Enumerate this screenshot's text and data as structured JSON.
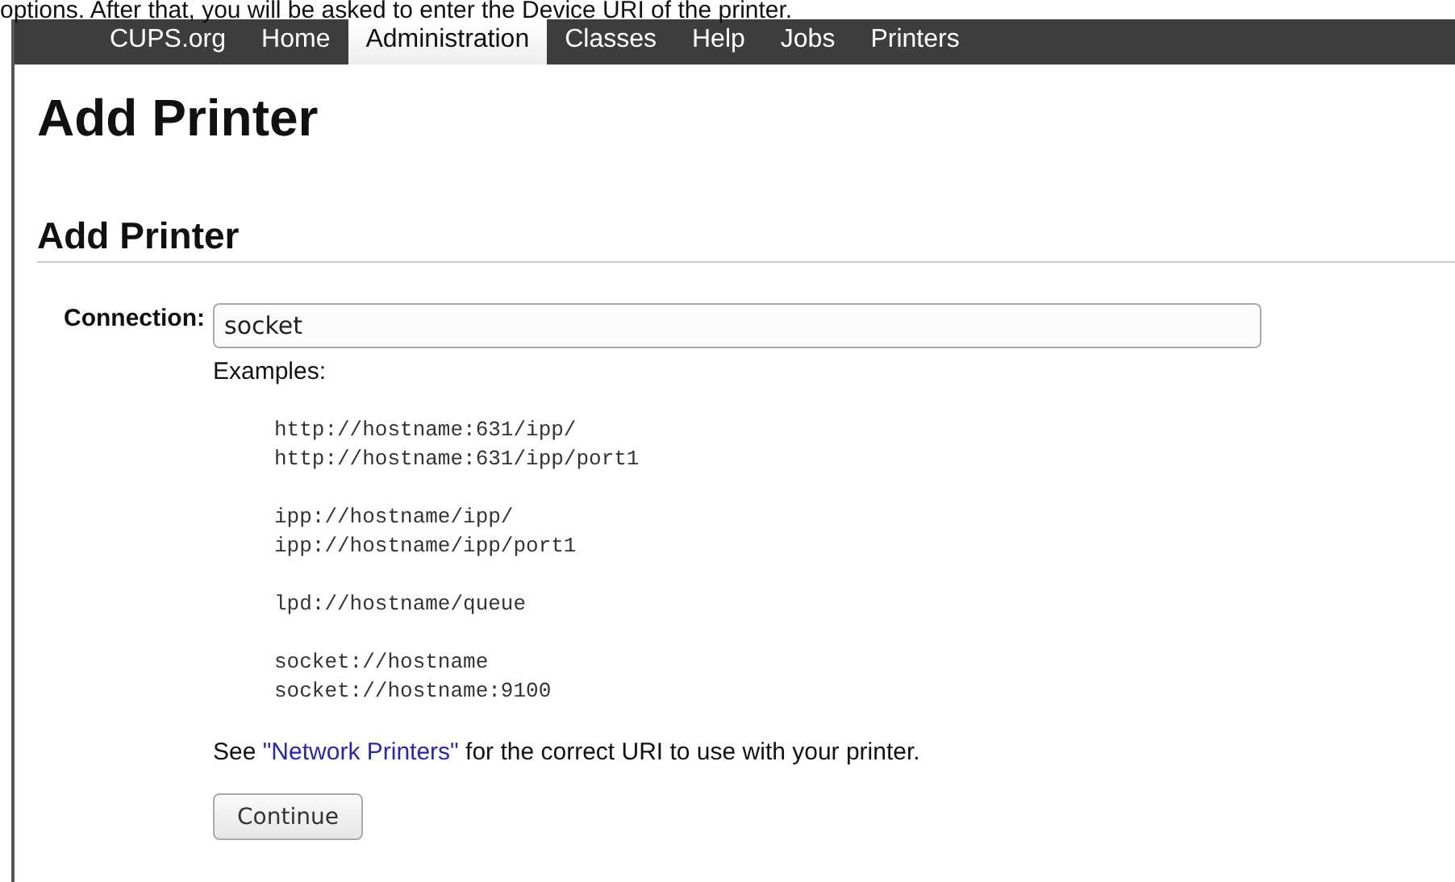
{
  "intro_text": "options. After that, you will be asked to enter the Device URI of the printer.",
  "nav": [
    {
      "label": "CUPS.org",
      "selected": false
    },
    {
      "label": "Home",
      "selected": false
    },
    {
      "label": "Administration",
      "selected": true
    },
    {
      "label": "Classes",
      "selected": false
    },
    {
      "label": "Help",
      "selected": false
    },
    {
      "label": "Jobs",
      "selected": false
    },
    {
      "label": "Printers",
      "selected": false
    }
  ],
  "page_title": "Add Printer",
  "section_title": "Add Printer",
  "form": {
    "label": "Connection:",
    "value": "socket",
    "examples_label": "Examples:",
    "example_groups": [
      [
        "http://hostname:631/ipp/",
        "http://hostname:631/ipp/port1"
      ],
      [
        "ipp://hostname/ipp/",
        "ipp://hostname/ipp/port1"
      ],
      [
        "lpd://hostname/queue"
      ],
      [
        "socket://hostname",
        "socket://hostname:9100"
      ]
    ],
    "note": {
      "before": "See ",
      "link": "\"Network Printers\"",
      "after": " for the correct URI to use with your printer."
    },
    "button": "Continue"
  }
}
